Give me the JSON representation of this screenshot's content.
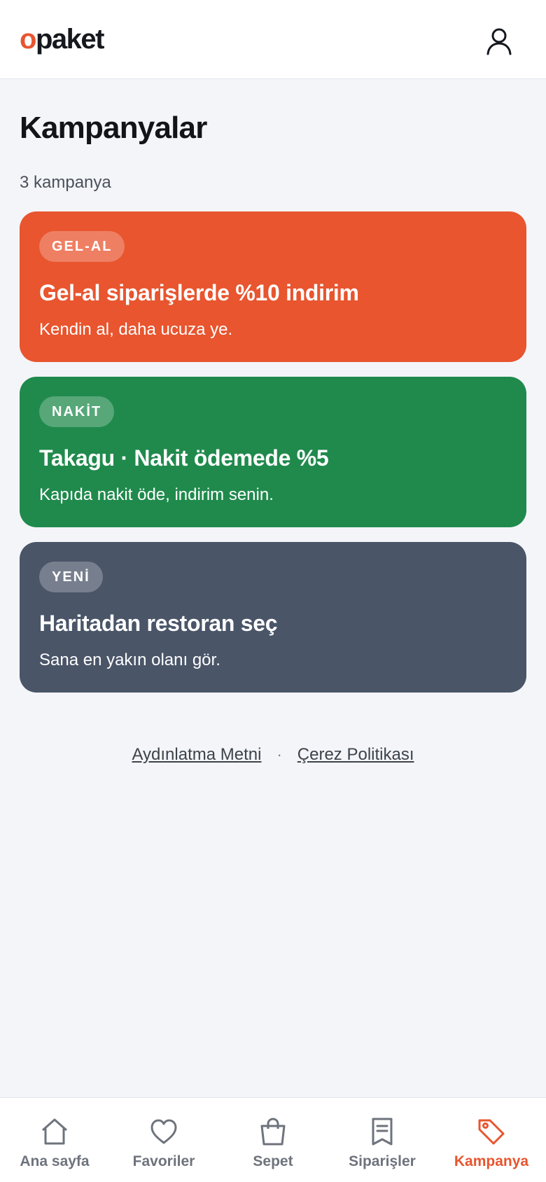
{
  "header": {
    "logo_o": "o",
    "logo_rest": "paket"
  },
  "main": {
    "title": "Kampanyalar",
    "count": "3 kampanya",
    "campaigns": [
      {
        "badge": "GEL-AL",
        "title": "Gel-al siparişlerde %10 indirim",
        "desc": "Kendin al, daha ucuza ye.",
        "color": "#e8552f"
      },
      {
        "badge": "NAKİT",
        "title": "Takagu · Nakit ödemede %5",
        "desc": "Kapıda nakit öde, indirim senin.",
        "color": "#1f8a4c"
      },
      {
        "badge": "YENİ",
        "title": "Haritadan restoran seç",
        "desc": "Sana en yakın olanı gör.",
        "color": "#4a5568"
      }
    ]
  },
  "footer": {
    "link1": "Aydınlatma Metni",
    "separator": "·",
    "link2": "Çerez Politikası"
  },
  "bottom_nav": {
    "items": [
      {
        "label": "Ana sayfa",
        "icon": "home-icon"
      },
      {
        "label": "Favoriler",
        "icon": "heart-icon"
      },
      {
        "label": "Sepet",
        "icon": "bag-icon"
      },
      {
        "label": "Siparişler",
        "icon": "receipt-icon"
      },
      {
        "label": "Kampanya",
        "icon": "tag-icon"
      }
    ],
    "active_color": "#e8552f",
    "inactive_color": "#6e737c"
  }
}
